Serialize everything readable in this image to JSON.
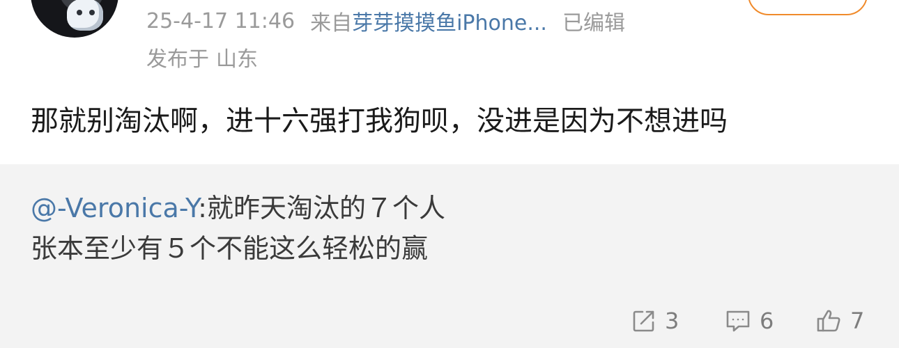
{
  "post": {
    "timestamp": "25-4-17 11:46",
    "source_prefix": "来自",
    "source_name": "芽芽摸摸鱼iPhone...",
    "edited_label": "已编辑",
    "location_prefix": "发布于",
    "location": "山东"
  },
  "comment": {
    "text": "那就别淘汰啊，进十六强打我狗呗，没进是因为不想进吗"
  },
  "quote": {
    "mention": "@-Veronica-Y",
    "line1_rest": ":就昨天淘汰的７个人",
    "line2": "张本至少有５个不能这么轻松的赢"
  },
  "actions": {
    "repost_count": "3",
    "comment_count": "6",
    "like_count": "7"
  },
  "colors": {
    "link_blue": "#4a78a8",
    "meta_gray": "#9a9a9a",
    "follow_orange": "#f08a2a",
    "quote_bg": "#f3f3f3"
  },
  "icons": [
    "repost-icon",
    "comment-icon",
    "like-icon"
  ]
}
